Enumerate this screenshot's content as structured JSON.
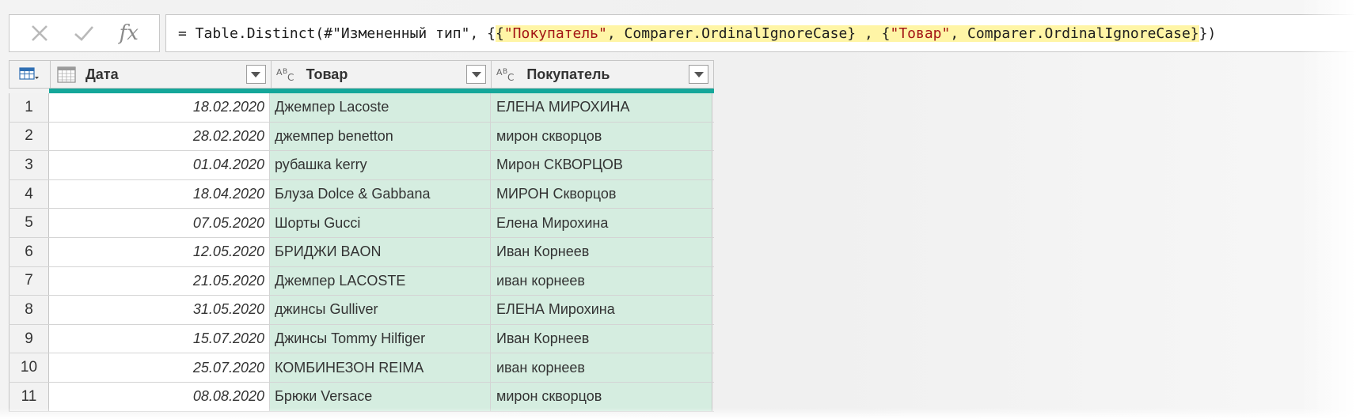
{
  "formula_bar": {
    "cancel_icon": "close-icon",
    "commit_icon": "check-icon",
    "fx_label": "fx",
    "formula_prefix": "= Table.Distinct(#\"Измененный тип\", {",
    "formula_hl_open": "{",
    "formula_str1": "\"Покупатель\"",
    "formula_mid1": ", Comparer.OrdinalIgnoreCase} , {",
    "formula_str2": "\"Товар\"",
    "formula_mid2": ", Comparer.OrdinalIgnoreCase}",
    "formula_suffix": "})"
  },
  "table": {
    "columns": [
      {
        "title": "Дата",
        "type_icon": "calendar-icon"
      },
      {
        "title": "Товар",
        "type_icon": "abc-text-icon"
      },
      {
        "title": "Покупатель",
        "type_icon": "abc-text-icon"
      }
    ],
    "rows": [
      {
        "n": "1",
        "date": "18.02.2020",
        "item": "Джемпер Lacoste",
        "buyer": "ЕЛЕНА МИРОХИНА"
      },
      {
        "n": "2",
        "date": "28.02.2020",
        "item": "джемпер benetton",
        "buyer": "мирон скворцов"
      },
      {
        "n": "3",
        "date": "01.04.2020",
        "item": "рубашка kerry",
        "buyer": "Мирон СКВОРЦОВ"
      },
      {
        "n": "4",
        "date": "18.04.2020",
        "item": "Блуза Dolce & Gabbana",
        "buyer": "МИРОН Скворцов"
      },
      {
        "n": "5",
        "date": "07.05.2020",
        "item": "Шорты Gucci",
        "buyer": "Елена Мирохина"
      },
      {
        "n": "6",
        "date": "12.05.2020",
        "item": "БРИДЖИ BAON",
        "buyer": "Иван Корнеев"
      },
      {
        "n": "7",
        "date": "21.05.2020",
        "item": "Джемпер LACOSTE",
        "buyer": "иван корнеев"
      },
      {
        "n": "8",
        "date": "31.05.2020",
        "item": "джинсы Gulliver",
        "buyer": "ЕЛЕНА Мирохина"
      },
      {
        "n": "9",
        "date": "15.07.2020",
        "item": "Джинсы Tommy Hilfiger",
        "buyer": "Иван Корнеев"
      },
      {
        "n": "10",
        "date": "25.07.2020",
        "item": "КОМБИНЕЗОН REIMA",
        "buyer": "иван корнеев"
      },
      {
        "n": "11",
        "date": "08.08.2020",
        "item": "Брюки Versace",
        "buyer": "мирон скворцов"
      }
    ]
  },
  "colors": {
    "accent_teal": "#15a79a",
    "selected_column_fill": "#d5ede0",
    "formula_highlight": "#fff5a6",
    "string_literal": "#a31515"
  }
}
